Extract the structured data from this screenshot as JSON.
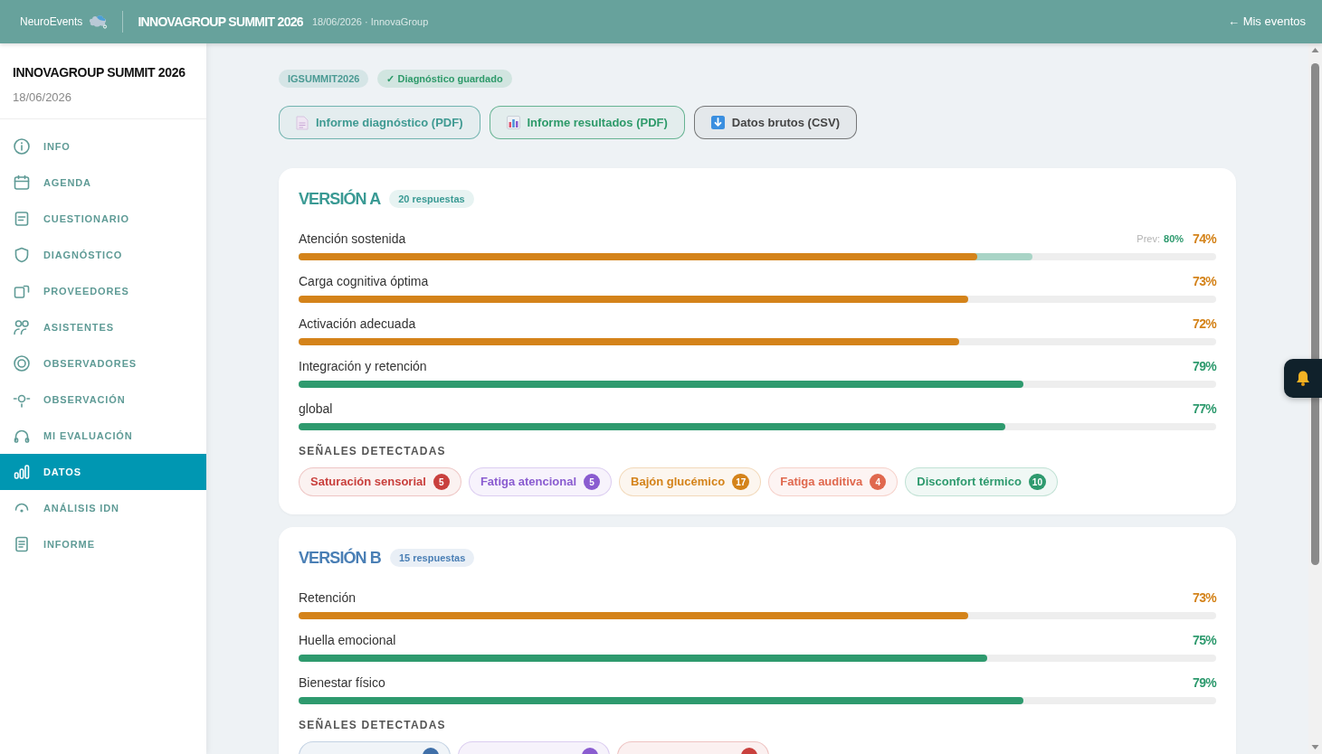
{
  "header": {
    "logo": "NeuroEvents",
    "title": "INNOVAGROUP SUMMIT 2026",
    "subtitle": "18/06/2026 · InnovaGroup",
    "back_link": "← Mis eventos"
  },
  "sidebar": {
    "title": "INNOVAGROUP SUMMIT 2026",
    "date": "18/06/2026",
    "items": [
      {
        "label": "INFO",
        "selected": false
      },
      {
        "label": "AGENDA",
        "selected": false
      },
      {
        "label": "CUESTIONARIO",
        "selected": false
      },
      {
        "label": "DIAGNÓSTICO",
        "selected": false
      },
      {
        "label": "PROVEEDORES",
        "selected": false
      },
      {
        "label": "ASISTENTES",
        "selected": false
      },
      {
        "label": "OBSERVADORES",
        "selected": false
      },
      {
        "label": "OBSERVACIÓN",
        "selected": false
      },
      {
        "label": "MI EVALUACIÓN",
        "selected": false
      },
      {
        "label": "DATOS",
        "selected": true
      },
      {
        "label": "ANÁLISIS IDN",
        "selected": false
      },
      {
        "label": "INFORME",
        "selected": false
      }
    ]
  },
  "tags": [
    {
      "label": "IGSUMMIT2026",
      "color": "#4a9a93"
    },
    {
      "label": "✓ Diagnóstico guardado",
      "color": "#2e9a6a"
    }
  ],
  "actions": [
    {
      "label": "Informe diagnóstico (PDF)",
      "color": "#3f9a92"
    },
    {
      "label": "Informe resultados (PDF)",
      "color": "#2e9a6a"
    },
    {
      "label": "Datos brutos (CSV)",
      "color": "#444444"
    }
  ],
  "versions": [
    {
      "title": "VERSIÓN A",
      "responses": "20 respuestas",
      "color": "#3a9a94",
      "metrics": [
        {
          "label": "Atención sostenida",
          "value": "74%",
          "level": 0.74,
          "color": "#d4831a",
          "previous": {
            "label": "Prev:",
            "value": "80%",
            "level": 0.8
          }
        },
        {
          "label": "Carga cognitiva óptima",
          "value": "73%",
          "level": 0.73,
          "color": "#d4831a"
        },
        {
          "label": "Activación adecuada",
          "value": "72%",
          "level": 0.72,
          "color": "#d4831a"
        },
        {
          "label": "Integración y retención",
          "value": "79%",
          "level": 0.79,
          "color": "#2e9a6e"
        },
        {
          "label": "global",
          "value": "77%",
          "level": 0.77,
          "color": "#2e9a6e"
        }
      ],
      "signals_heading": "SEÑALES DETECTADAS",
      "signals": [
        {
          "label": "Saturación sensorial",
          "count": "5",
          "color": "#c9403d"
        },
        {
          "label": "Fatiga atencional",
          "count": "5",
          "color": "#8a5cd0"
        },
        {
          "label": "Bajón glucémico",
          "count": "17",
          "color": "#d4831a"
        },
        {
          "label": "Fatiga auditiva",
          "count": "4",
          "color": "#e0684e"
        },
        {
          "label": "Disconfort térmico",
          "count": "10",
          "color": "#2e9a6e"
        }
      ]
    },
    {
      "title": "VERSIÓN B",
      "responses": "15 respuestas",
      "color": "#4a7fb5",
      "metrics": [
        {
          "label": "Retención",
          "value": "73%",
          "level": 0.73,
          "color": "#d4831a"
        },
        {
          "label": "Huella emocional",
          "value": "75%",
          "level": 0.75,
          "color": "#2e9a6e"
        },
        {
          "label": "Bienestar físico",
          "value": "79%",
          "level": 0.79,
          "color": "#2e9a6e"
        }
      ],
      "signals_heading": "SEÑALES DETECTADAS",
      "signals": [
        {
          "color": "#3f6fa8"
        },
        {
          "color": "#8a5cd0"
        },
        {
          "color": "#c9403d"
        }
      ]
    }
  ]
}
